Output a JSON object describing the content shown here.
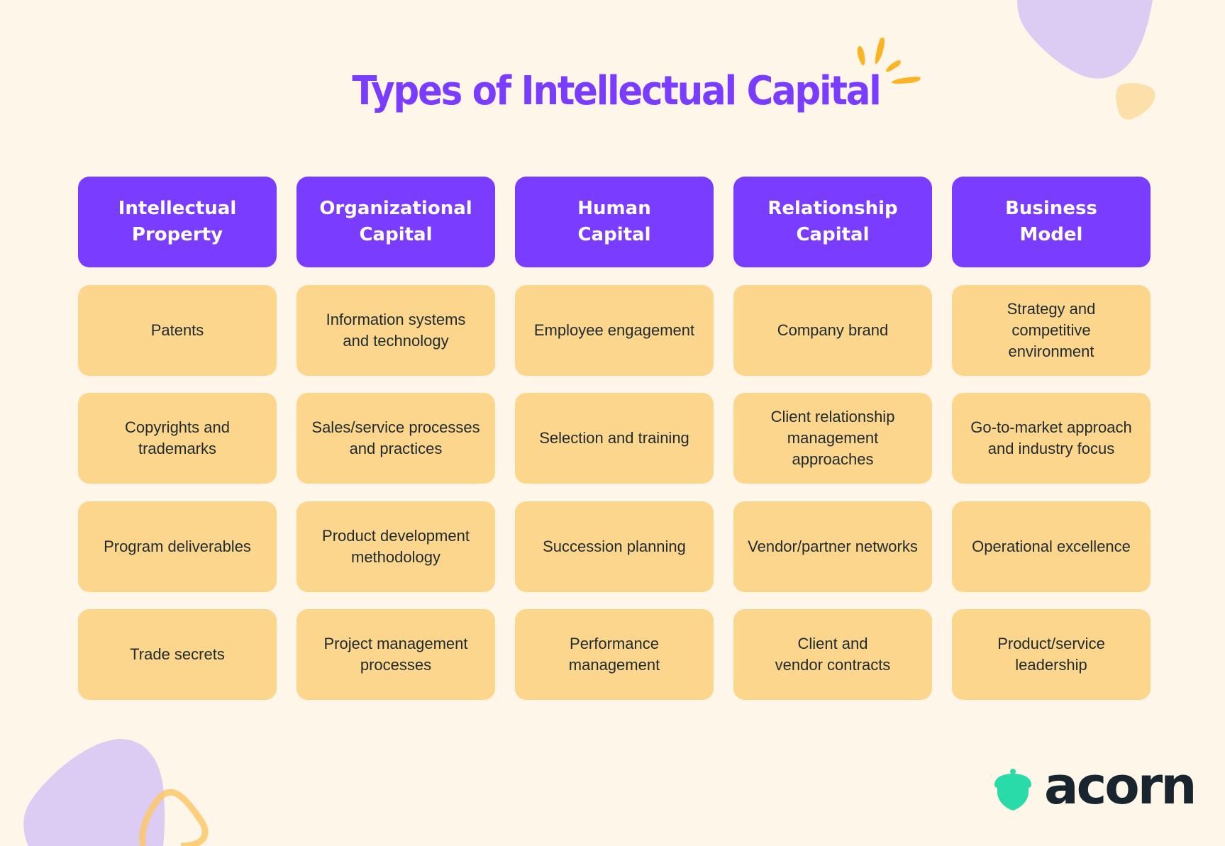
{
  "title": "Types of Intellectual Capital",
  "colors": {
    "background": "#fef6e8",
    "header_purple": "#7a3cff",
    "cell_yellow": "#fcd68c",
    "accent_orange": "#fbb424",
    "blob_lavender": "#dccbf2",
    "logo_green": "#28dba8",
    "text_dark": "#1f2a2e"
  },
  "columns": [
    {
      "header": "Intellectual\nProperty",
      "items": [
        "Patents",
        "Copyrights and\ntrademarks",
        "Program deliverables",
        "Trade secrets"
      ]
    },
    {
      "header": "Organizational\nCapital",
      "items": [
        "Information systems\nand technology",
        "Sales/service processes\nand practices",
        "Product development\nmethodology",
        "Project management\nprocesses"
      ]
    },
    {
      "header": "Human\nCapital",
      "items": [
        "Employee engagement",
        "Selection and training",
        "Succession planning",
        "Performance\nmanagement"
      ]
    },
    {
      "header": "Relationship\nCapital",
      "items": [
        "Company brand",
        "Client relationship\nmanagement\napproaches",
        "Vendor/partner networks",
        "Client and\nvendor contracts"
      ]
    },
    {
      "header": "Business\nModel",
      "items": [
        "Strategy and\ncompetitive\nenvironment",
        "Go-to-market approach\nand industry focus",
        "Operational excellence",
        "Product/service\nleadership"
      ]
    }
  ],
  "logo": {
    "icon": "acorn-icon",
    "text": "acorn"
  }
}
